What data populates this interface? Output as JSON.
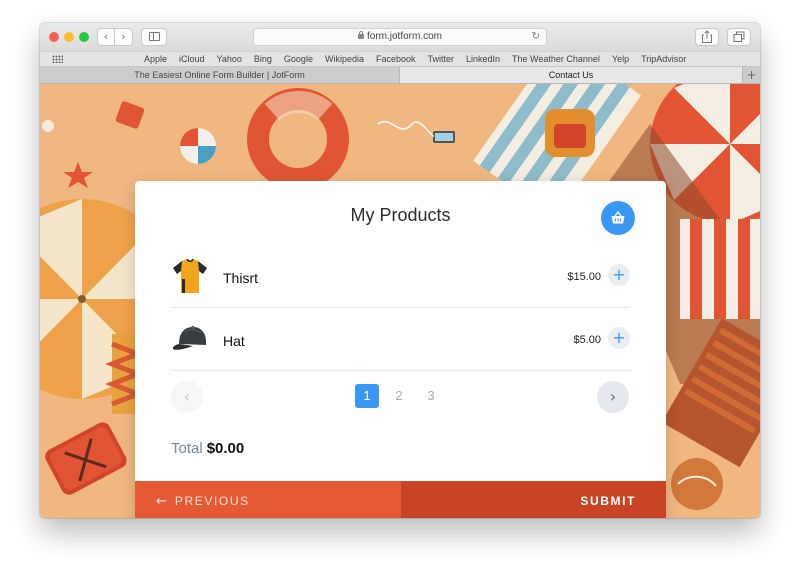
{
  "browser": {
    "url": "form.jotform.com",
    "bookmarks": [
      "Apple",
      "iCloud",
      "Yahoo",
      "Bing",
      "Google",
      "Wikipedia",
      "Facebook",
      "Twitter",
      "LinkedIn",
      "The Weather Channel",
      "Yelp",
      "TripAdvisor"
    ],
    "tabs": [
      {
        "label": "The Easiest Online Form Builder | JotForm",
        "active": false
      },
      {
        "label": "Contact Us",
        "active": true
      }
    ],
    "nav": {
      "back_glyph": "‹",
      "forward_glyph": "›",
      "reload_glyph": "↻",
      "new_tab_glyph": "+"
    }
  },
  "form": {
    "title": "My Products",
    "cart_icon": "basket-icon",
    "products": [
      {
        "name": "Thisrt",
        "price": "$15.00",
        "image": "tshirt-icon",
        "add_glyph": "+"
      },
      {
        "name": "Hat",
        "price": "$5.00",
        "image": "cap-icon",
        "add_glyph": "+"
      }
    ],
    "pagination": {
      "pages": [
        "1",
        "2",
        "3"
      ],
      "current": "1",
      "prev_glyph": "‹",
      "next_glyph": "›"
    },
    "total_label": "Total",
    "total_value": "$0.00",
    "previous_label": "PREVIOUS",
    "previous_arrow": "←",
    "submit_label": "SUBMIT"
  },
  "colors": {
    "accent": "#3a98f5",
    "previous_button": "#e55a35",
    "submit_button": "#c84425",
    "page_background": "#f1b781"
  }
}
